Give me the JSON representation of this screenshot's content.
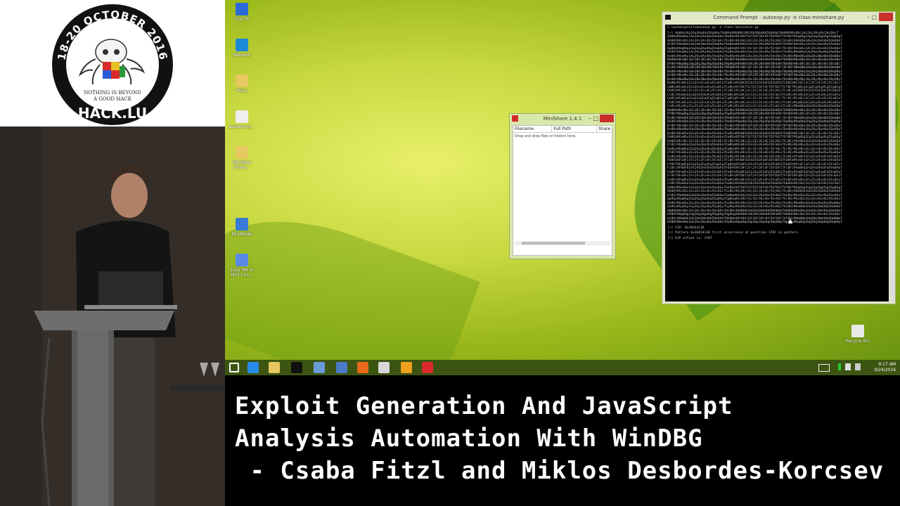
{
  "logo": {
    "arc_text": "18-20 OCTOBER 2016",
    "tagline_1": "NOTHING IS BEYOND",
    "tagline_2": "A GOOD HACK",
    "name": "HACK.LU"
  },
  "desktop": {
    "icons": [
      {
        "label": "This PC",
        "icon": "computer-icon",
        "color": "#2a6ad8"
      },
      {
        "label": "Network",
        "icon": "network-icon",
        "color": "#1a8ad8"
      },
      {
        "label": "POCs",
        "icon": "folder-icon",
        "color": "#e8c860"
      },
      {
        "label": "autoexp.js...",
        "icon": "script-icon",
        "color": "#eeeeee"
      },
      {
        "label": "Windows Share...",
        "icon": "folder-icon",
        "color": "#e8c860"
      },
      {
        "label": "MiniMode",
        "icon": "media-icon",
        "color": "#3a7ad8"
      },
      {
        "label": "Easy RM to MP3 Con...",
        "icon": "audio-converter-icon",
        "color": "#5a8ae8"
      }
    ],
    "recycle_bin": "Recycle Bin"
  },
  "minishare": {
    "title": "MiniShare 1.4.1",
    "columns": [
      "Filename",
      "Full Path",
      "Share"
    ],
    "empty_text": "Drag and drop files or folders here."
  },
  "cmd": {
    "title": "Command Prompt - autoexp.py -e class-minishare.py",
    "prompt_line": "C:\\autoexploit>autoexp.py -e class-minishare.py",
    "pattern_lines": [
      "[+] Aa0Aa1Aa2Aa3Aa4Aa5Aa6Aa7Aa8Aa9Ab0Ab1Ab2Ab3Ab4Ab5Ab6Ab7Ab8Ab9Ac0Ac1Ac2Ac3Ac4Ac5Ac6Ac7",
      "Ad8Ad9Ae0Ae1Ae2Ae3Ae4Ae5Ae6Ae7Ae8Ae9Af0Af1Af2Af3Af4Af5Af6Af7Af8Af9Ag0Ag1Ag2Ag3Ag4Ag5Ag6Ag7",
      "Ah8Ah9Ai0Ai1Ai2Ai3Ai4Ai5Ai6Ai7Ai8Ai9Aj0Aj1Aj2Aj3Aj4Aj5Aj6Aj7Aj8Aj9Ak0Ak1Ak2Ak3Ak4Ak5Ak6Ak7",
      "Al8Al9Am0Am1Am2Am3Am4Am5Am6Am7Am8Am9An0An1An2An3An4An5An6An7An8An9Ao0Ao1Ao2Ao3Ao4Ao5Ao6Ao7",
      "Ap8Ap9Aq0Aq1Aq2Aq3Aq4Aq5Aq6Aq7Aq8Aq9Ar0Ar1Ar2Ar3Ar4Ar5Ar6Ar7Ar8Ar9As0As1As2As3As4As5As6As7",
      "At8At9Au0Au1Au2Au3Au4Au5Au6Au7Au8Au9Av0Av1Av2Av3Av4Av5Av6Av7Av8Av9Aw0Aw1Aw2Aw3Aw4Aw5Aw6Aw7",
      "Ax8Ax9Ay0Ay1Ay2Ay3Ay4Ay5Ay6Ay7Ay8Ay9Az0Az1Az2Az3Az4Az5Az6Az7Az8Az9Ba0Ba1Ba2Ba3Ba4Ba5Ba6Ba7",
      "Bb8Bb9Bc0Bc1Bc2Bc3Bc4Bc5Bc6Bc7Bc8Bc9Bd0Bd1Bd2Bd3Bd4Bd5Bd6Bd7Bd8Bd9Be0Be1Be2Be3Be4Be5Be6Be7",
      "Bf8Bf9Bg0Bg1Bg2Bg3Bg4Bg5Bg6Bg7Bg8Bg9Bh0Bh1Bh2Bh3Bh4Bh5Bh6Bh7Bh8Bh9Bi0Bi1Bi2Bi3Bi4Bi5Bi6Bi7",
      "Bj8Bj9Bk0Bk1Bk2Bk3Bk4Bk5Bk6Bk7Bk8Bk9Bl0Bl1Bl2Bl3Bl4Bl5Bl6Bl7Bl8Bl9Bm0Bm1Bm2Bm3Bm4Bm5Bm6Bm7",
      "Bn8Bn9Bo0Bo1Bo2Bo3Bo4Bo5Bo6Bo7Bo8Bo9Bp0Bp1Bp2Bp3Bp4Bp5Bp6Bp7Bp8Bp9Bq0Bq1Bq2Bq3Bq4Bq5Bq6Bq7",
      "Br8Br9Bs0Bs1Bs2Bs3Bs4Bs5Bs6Bs7Bs8Bs9Bt0Bt1Bt2Bt3Bt4Bt5Bt6Bt7Bt8Bt9Bu0Bu1Bu2Bu3Bu4Bu5Bu6Bu7",
      "Bv8Bv9Bw0Bw1Bw2Bw3Bw4Bw5Bw6Bw7Bw8Bw9Bx0Bx1Bx2Bx3Bx4Bx5Bx6Bx7Bx8Bx9By0By1By2By3By4By5By6By7",
      "Bz8Bz9Ca0Ca1Ca2Ca3Ca4Ca5Ca6Ca7Ca8Ca9Cb0Cb1Cb2Cb3Cb4Cb5Cb6Cb7Cb8Cb9Cc0Cc1Cc2Cc3Cc4Cc5Cc6Cc7",
      "Cd8Cd9Ce0Ce1Ce2Ce3Ce4Ce5Ce6Ce7Ce8Ce9Cf0Cf1Cf2Cf3Cf4Cf5Cf6Cf7Cf8Cf9Cg0Cg1Cg2Cg3Cg4Cg5Cg6Cg7",
      "Ch8Ch9Ci0Ci1Ci2Ci3Ci4Ci5Ci6Ci7Ci8Ci9Cj0Cj1Cj2Cj3Cj4Cj5Cj6Cj7Cj8Cj9Ck0Ck1Ck2Ck3Ck4Ck5Ck6Ck7",
      "Cl8Cl9Cm0Cm1Cm2Cm3Cm4Cm5Cm6Cm7Cm8Cm9Cn0Cn1Cn2Cn3Cn4Cn5Cn6Cn7Cn8Cn9Co0Co1Co2Co3Co4Co5Co6Co7",
      "Cp8Cp9Cq0Cq1Cq2Cq3Cq4Cq5Cq6Cq7Cq8Cq9Cr0Cr1Cr2Cr3Cr4Cr5Cr6Cr7Cr8Cr9Cs0Cs1Cs2Cs3Cs4Cs5Cs6Cs7",
      "Ct8Ct9Cu0Cu1Cu2Cu3Cu4Cu5Cu6Cu7Cu8Cu9Cv0Cv1Cv2Cv3Cv4Cv5Cv6Cv7Cv8Cv9Cw0Cw1Cw2Cw3Cw4Cw5Cw6Cw7",
      "Cx8Cx9Cy0Cy1Cy2Cy3Cy4Cy5Cy6Cy7Cy8Cy9Cz0Cz1Cz2Cz3Cz4Cz5Cz6Cz7Cz8Cz9Da0Da1Da2Da3Da4Da5Da6Da7",
      "Db8Db9Dc0Dc1Dc2Dc3Dc4Dc5Dc6Dc7Dc8Dc9Dd0Dd1Dd2Dd3Dd4Dd5Dd6Dd7Dd8Dd9De0De1De2De3De4De5De6De7",
      "Df8Df9Dg0Dg1Dg2Dg3Dg4Dg5Dg6Dg7Dg8Dg9Dh0Dh1Dh2Dh3Dh4Dh5Dh6Dh7Dh8Dh9Di0Di1Di2Di3Di4Di5Di6Di7",
      "Dj8Dj9Dk0Dk1Dk2Dk3Dk4Dk5Dk6Dk7Dk8Dk9Dl0Dl1Dl2Dl3Dl4Dl5Dl6Dl7Dl8Dl9Dm0Dm1Dm2Dm3Dm4Dm5Dm6Dm7",
      "Dn8Dn9Do0Do1Do2Do3Do4Do5Do6Do7Do8Do9Dp0Dp1Dp2Dp3Dp4Dp5Dp6Dp7Dp8Dp9Dq0Dq1Dq2Dq3Dq4Dq5Dq6Dq7",
      "Dr8Dr9Ds0Ds1Ds2Ds3Ds4Ds5Ds6Ds7Ds8Ds9Dt0Dt1Dt2Dt3Dt4Dt5Dt6Dt7Dt8Dt9Du0Du1Du2Du3Du4Du5Du6Du7",
      "Dv8Dv9Dw0Dw1Dw2Dw3Dw4Dw5Dw6Dw7Dw8Dw9Dx0Dx1Dx2Dx3Dx4Dx5Dx6Dx7Dx8Dx9Dy0Dy1Dy2Dy3Dy4Dy5Dy6Dy7",
      "Dz8Dz9Ea0Ea1Ea2Ea3Ea4Ea5Ea6Ea7Ea8Ea9Eb0Eb1Eb2Eb3Eb4Eb5Eb6Eb7Eb8Eb9Ec0Ec1Ec2Ec3Ec4Ec5Ec6Ec7",
      "Ed8Ed9Ee0Ee1Ee2Ee3Ee4Ee5Ee6Ee7Ee8Ee9Ef0Ef1Ef2Ef3Ef4Ef5Ef6Ef7Ef8Ef9Eg0Eg1Eg2Eg3Eg4Eg5Eg6Eg7",
      "Eh8Eh9Ei0Ei1Ei2Ei3Ei4Ei5Ei6Ei7Ei8Ei9Ej0Ej1Ej2Ej3Ej4Ej5Ej6Ej7Ej8Ej9Ek0Ek1Ek2Ek3Ek4Ek5Ek6Ek7",
      "El8El9Em0Em1Em2Em3Em4Em5Em6Em7Em8Em9En0En1En2En3En4En5En6En7En8En9Eo0Eo1Eo2Eo3Eo4Eo5Eo6Eo7",
      "Ep8Ep9Eq0Eq1Eq2Eq3Eq4Eq5Eq6Eq7Eq8Eq9Er0Er1Er2Er3Er4Er5Er6Er7Er8Er9Es0Es1Es2Es3Es4Es5Es6Es7",
      "Et8Et9Eu0Eu1Eu2Eu3Eu4Eu5Eu6Eu7Eu8Eu9Ev0Ev1Ev2Ev3Ev4Ev5Ev6Ev7Ev8Ev9Ew0Ew1Ew2Ew3Ew4Ew5Ew6Ew7",
      "Ex8Ex9Ey0Ey1Ey2Ey3Ey4Ey5Ey6Ey7Ey8Ey9Ez0Ez1Ez2Ez3Ez4Ez5Ez6Ez7Ez8Ez9Fa0Fa1Fa2Fa3Fa4Fa5Fa6Fa7",
      "Fb8Fb9Fc0Fc1Fc2Fc3Fc4Fc5Fc6Fc7Fc8Fc9Fd0Fd1Fd2Fd3Fd4Fd5Fd6Fd7Fd8Fd9Fe0Fe1Fe2Fe3Fe4Fe5Fe6Fe7",
      "Ff8Ff9Fg0Fg1Fg2Fg3Fg4Fg5Fg6Fg7Fg8Fg9Fh0Fh1Fh2Fh3Fh4Fh5Fh6Fh7Fh8Fh9Fi0Fi1Fi2Fi3Fi4Fi5Fi6Fi7",
      "Fj8Fj9Fk0Fk1Fk2Fk3Fk4Fk5Fk6Fk7Fk8Fk9Fl0Fl1Fl2Fl3Fl4Fl5Fl6Fl7Fl8Fl9Fm0Fm1Fm2Fm3Fm4Fm5Fm6Fm7",
      "Fn8Fn9Fo0Fo1Fo2Fo3Fo4Fo5Fo6Fo7Fo8Fo9Fp0Fp1Fp2Fp3Fp4Fp5Fp6Fp7Fp8Fp9Fq0Fq1Fq2Fq3Fq4Fq5Fq6Fq7",
      "Fr8Fr9Fs0Fs1Fs2Fs3Fs4Fs5Fs6Fs7Fs8Fs9Ft0Ft1Ft2Ft3Ft4Ft5Ft6Ft7Ft8Ft9Fu0Fu1Fu2Fu3Fu4Fu5Fu6Fu7",
      "Fv8Fv9Fw0Fw1Fw2Fw3Fw4Fw5Fw6Fw7Fw8Fw9Fx0Fx1Fx2Fx3Fx4Fx5Fx6Fx7Fx8Fx9Fy0Fy1Fy2Fy3Fy4Fy5Fy6Fy7",
      "Fz8Fz9Ga0Ga1Ga2Ga3Ga4Ga5Ga6Ga7Ga8Ga9Gb0Gb1Gb2Gb3Gb4Gb5Gb6Gb7Gb8Gb9Gc0Gc1Gc2Gc3Gc4Gc5Gc6Gc7",
      "Gd8Gd9Ge0Ge1Ge2Ge3Ge4Ge5Ge6Ge7Ge8Ge9Gf0Gf1Gf2Gf3Gf4Gf5Gf6Gf7Gf8Gf9Gg0Gg1Gg2Gg3Gg4Gg5Gg6Gg7",
      "Gh8Gh9Gi0Gi1Gi2Gi3Gi4Gi5Gi6Gi7Gi8Gi9Gj0Gj1Gj2Gj3Gj4Gj5Gj6Gj7Gj8Gj9Gk0Gk1Gk2Gk3Gk4Gk5Gk6Gk7",
      "Gl8Gl9Gm0Gm1Gm2Gm3Gm4Gm5Gm6Gm7Gm8Gm9Gn0Gn1Gn2Gn3Gn4Gn5Gn6Gn7Gn8Gn9Go0Go1Go2Go3Go4Go5Go6Go7",
      "Gp8Gp9Gq0Gq1Gq2Gq3Gq4Gq5Gq6Gq7Gq8Gq9Gr0Gr1Gr2Gr3Gr4Gr5Gr6Gr7Gr8Gr9Gs0Gs1Gs2Gs3Gs4Gs5Gs6Gs7",
      "Gt8Gt9Gu0Gu1Gu2Gu3Gu4Gu5Gu6Gu7Gu8Gu9Gv0Gv1Gv2Gv3Gv4Gv5Gv6Gv7Gv8Gv9Gw0Gw1Gw2Gw3Gw4Gw5Gw6Gw7",
      "Gx8Gx9Gy0Gy1Gy2Gy3Gy4Gy5Gy6Gy7Gy8Gy9Gz0Gz1Gz2Gz3Gz4Gz5Gz6Gz7Gz8Gz9Ha0Ha1Ha2Ha3Ha4Ha5Ha6Ha7",
      "Hb8Hb9Hc0Hc1Hc2Hc3Hc4Hc5Hc6Hc7Hc8Hc9Hd0Hd1Hd2Hd3Hd4Hd5Hd6Hd7Hd8Hd9He0He1He2He3He4He5He6He7",
      "Hf8Hf9Hg0Hg1Hg2Hg3Hg4Hg5Hg6Hg7Hg8Hg9Hh0Hh1Hh2Hh3Hh4Hh5Hh6Hh7Hh8Hh9Hi0Hi1Hi2Hi3Hi4Hi5Hi6Hi7",
      "Hj8Hj9Hk0Hk1Hk2Hk3Hk4Hk5Hk6Hk7Hk8Hk9Hl0Hl1Hl2Hl3Hl4Hl5Hl6Hl7Hl8Hl9Hm0Hm1Hm2Hm3Hm4Hm5Hm6Hm7",
      "Hn8Hn9Ho0Ho1Ho2Ho3Ho4Ho5Ho6Ho7Ho8Ho9Hp0Hp1Hp2Hp3Hp4Hp5Hp6Hp7Hp8Hp9Hq0Hq1Hq2Hq3Hq4Hq5Hq6Hq7"
    ],
    "eip_line": "[+] EIP: 0x36654136",
    "pattern_line": "[+] Pattern 0x36654136 first occurrence at position 1787 in pattern.",
    "offset_line": "[+] EIP offset is: 1787"
  },
  "taskbar": {
    "apps": [
      {
        "icon": "windows-start-icon",
        "color": "#ffffff"
      },
      {
        "icon": "internet-explorer-icon",
        "color": "#2a8ae8"
      },
      {
        "icon": "file-explorer-icon",
        "color": "#e8c860"
      },
      {
        "icon": "command-prompt-icon",
        "color": "#111111"
      },
      {
        "icon": "windbg-icon",
        "color": "#6a9ad8"
      },
      {
        "icon": "monitor-app-icon",
        "color": "#4a7ac8"
      },
      {
        "icon": "firefox-icon",
        "color": "#e86a1a"
      },
      {
        "icon": "tool-app-icon",
        "color": "#d8d8d8"
      },
      {
        "icon": "media-app-icon",
        "color": "#f0a020"
      },
      {
        "icon": "minishare-icon",
        "color": "#d82a2a"
      }
    ],
    "time": "9:17 AM",
    "date": "9/24/2016"
  },
  "caption": {
    "line1": "Exploit Generation And JavaScript",
    "line2": "Analysis Automation With WinDBG",
    "line3": " - Csaba Fitzl and Miklos Desbordes-Korcsev"
  }
}
